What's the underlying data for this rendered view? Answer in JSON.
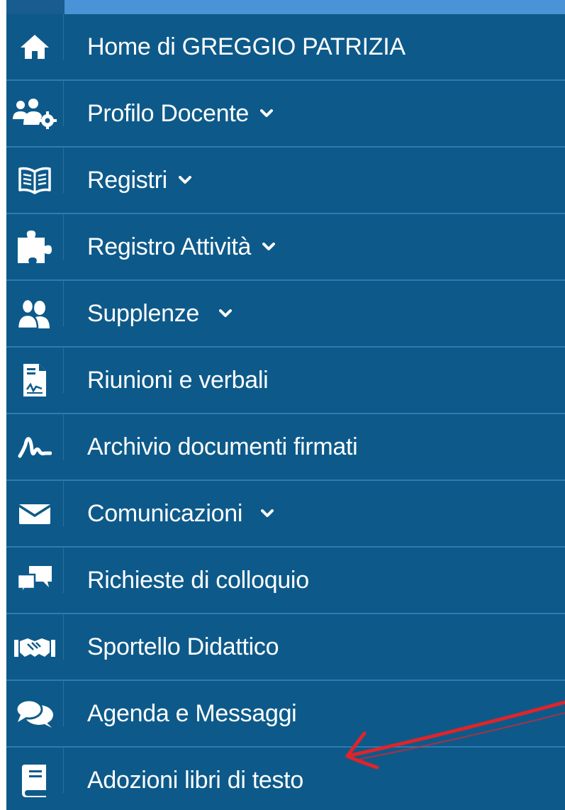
{
  "menu": {
    "items": [
      {
        "label": "Home di GREGGIO PATRIZIA",
        "icon": "home-icon",
        "has_dropdown": false
      },
      {
        "label": "Profilo Docente",
        "icon": "users-gear-icon",
        "has_dropdown": true
      },
      {
        "label": "Registri",
        "icon": "open-book-icon",
        "has_dropdown": true
      },
      {
        "label": "Registro Attività",
        "icon": "puzzle-icon",
        "has_dropdown": true
      },
      {
        "label": "Supplenze",
        "icon": "user-group-icon",
        "has_dropdown": true
      },
      {
        "label": "Riunioni e verbali",
        "icon": "document-signature-icon",
        "has_dropdown": false
      },
      {
        "label": "Archivio documenti firmati",
        "icon": "signature-icon",
        "has_dropdown": false
      },
      {
        "label": "Comunicazioni",
        "icon": "envelope-icon",
        "has_dropdown": true
      },
      {
        "label": "Richieste di colloquio",
        "icon": "chat-bubbles-icon",
        "has_dropdown": false
      },
      {
        "label": "Sportello Didattico",
        "icon": "handshake-icon",
        "has_dropdown": false
      },
      {
        "label": "Agenda e Messaggi",
        "icon": "comments-icon",
        "has_dropdown": false
      },
      {
        "label": "Adozioni libri di testo",
        "icon": "book-icon",
        "has_dropdown": false
      }
    ]
  },
  "colors": {
    "sidebar_bg": "#0d5a8a",
    "topbar_accent": "#4a93d6",
    "divider": "#2d7bb0",
    "text": "#ffffff",
    "annotation_arrow": "#e0242a"
  }
}
